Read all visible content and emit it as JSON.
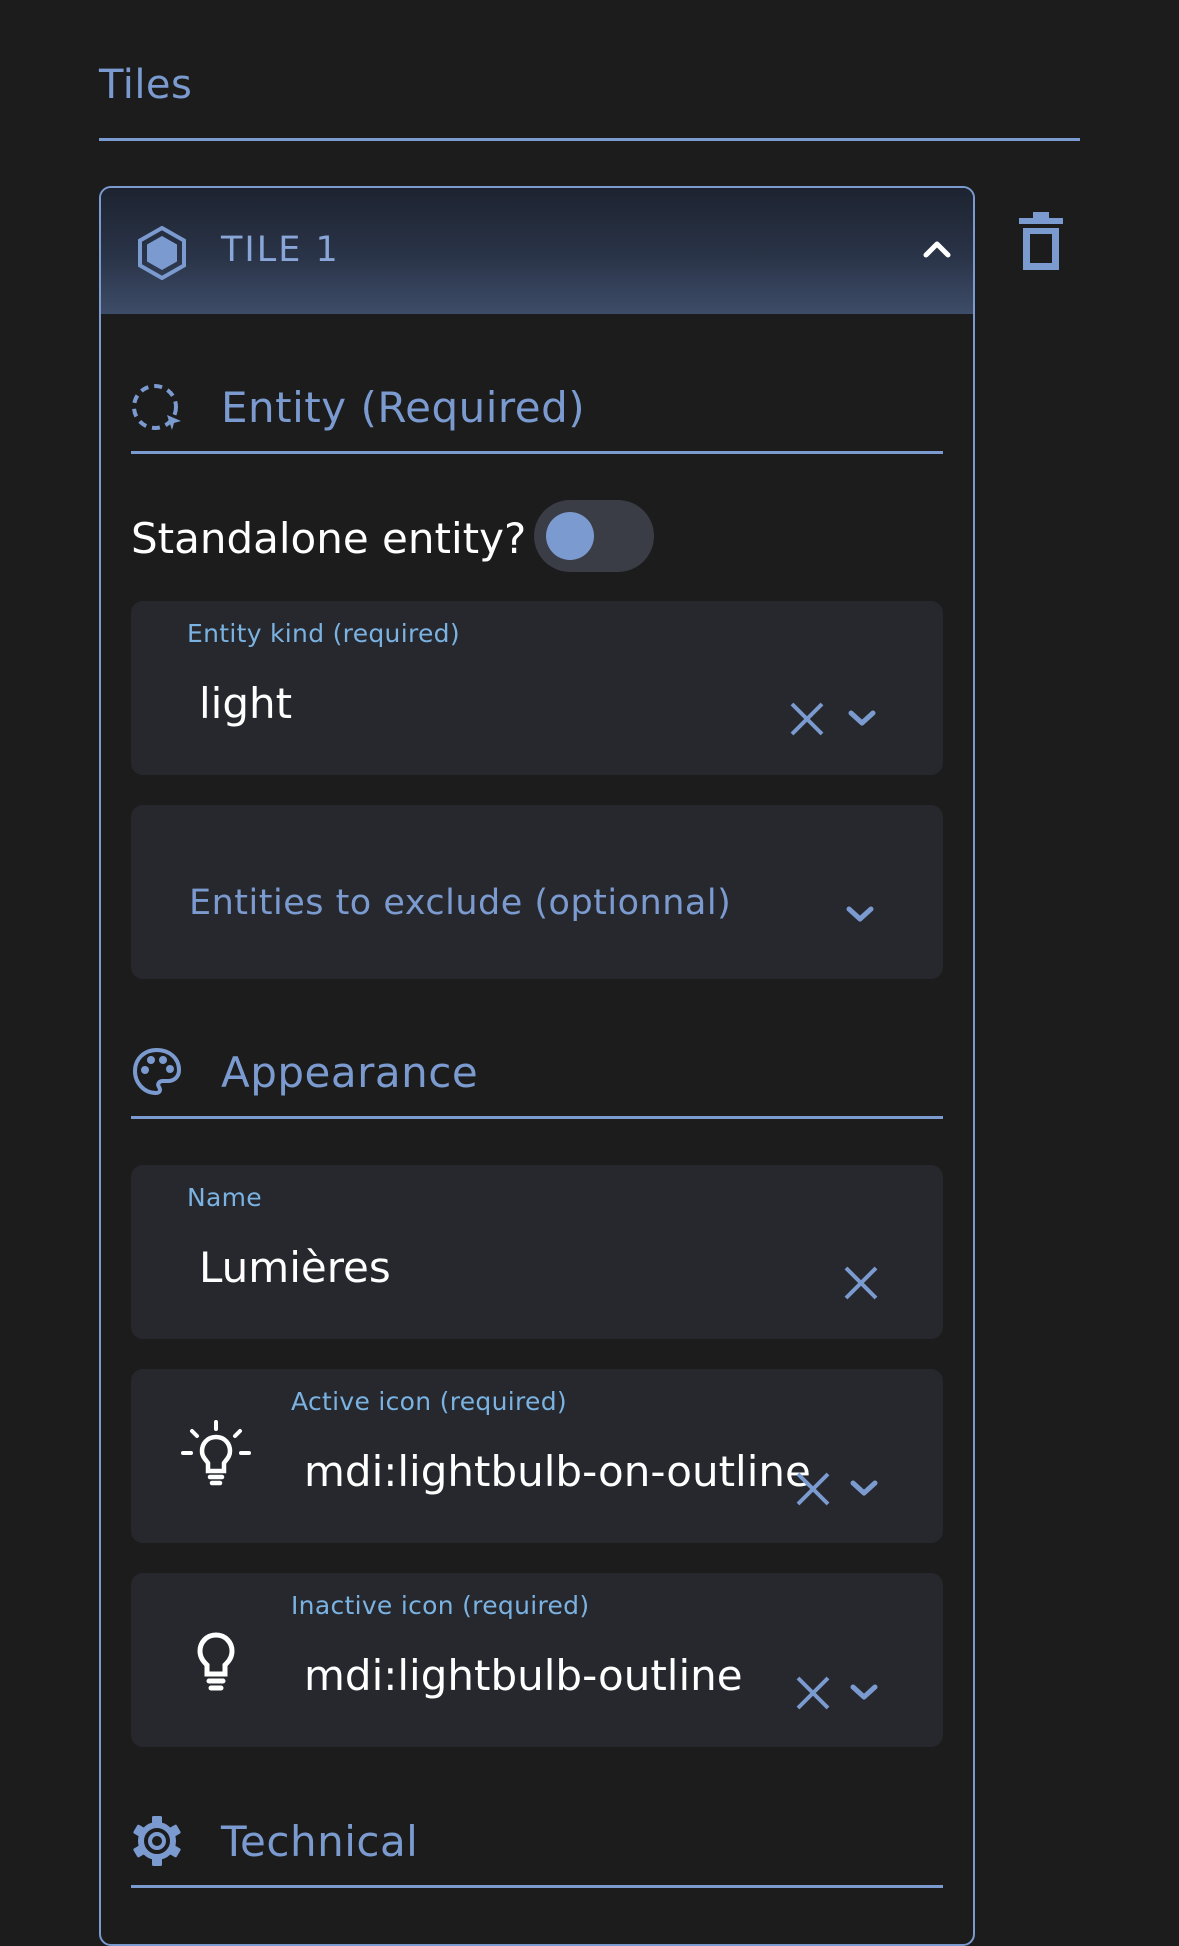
{
  "section": {
    "title": "Tiles"
  },
  "tile": {
    "title": "TILE 1",
    "entity_section": {
      "title": "Entity (Required)"
    },
    "standalone": {
      "label": "Standalone entity?",
      "checked": false
    },
    "entity_kind": {
      "label": "Entity kind (required)",
      "value": "light"
    },
    "exclude": {
      "placeholder": "Entities to exclude (optionnal)"
    },
    "appearance_section": {
      "title": "Appearance"
    },
    "name": {
      "label": "Name",
      "value": "Lumières"
    },
    "active_icon": {
      "label": "Active icon (required)",
      "value": "mdi:lightbulb-on-outline",
      "icon": "lightbulb-on-outline-icon"
    },
    "inactive_icon": {
      "label": "Inactive icon (required)",
      "value": "mdi:lightbulb-outline",
      "icon": "lightbulb-outline-icon"
    },
    "technical_section": {
      "title": "Technical"
    }
  },
  "colors": {
    "accent": "#7b9bd0",
    "label": "#7ab2e2",
    "background": "#1c1c1c",
    "field_bg": "#27282d",
    "text": "#ffffff"
  }
}
